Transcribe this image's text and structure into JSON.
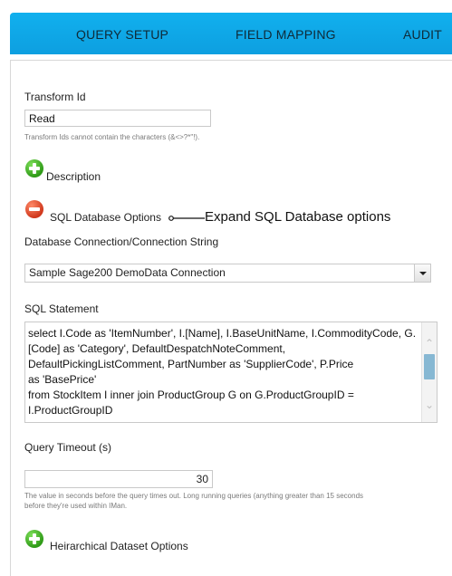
{
  "tabs": [
    {
      "label": "QUERY SETUP"
    },
    {
      "label": "FIELD MAPPING"
    },
    {
      "label": "AUDIT"
    }
  ],
  "transform": {
    "label": "Transform Id",
    "value": "Read",
    "hint": "Transform Ids cannot contain the characters (&<>?*\"!)."
  },
  "sections": {
    "description": "Description",
    "sql_options": "SQL Database Options",
    "hierarchical": "Heirarchical Dataset Options"
  },
  "callout": "Expand SQL Database options",
  "connection": {
    "label": "Database Connection/Connection String",
    "selected": "Sample Sage200 DemoData Connection"
  },
  "sql": {
    "label": "SQL Statement",
    "text": "select I.Code as 'ItemNumber', I.[Name], I.BaseUnitName, I.CommodityCode, G.[Code] as 'Category', DefaultDespatchNoteComment, DefaultPickingListComment, PartNumber as 'SupplierCode', P.Price\nas 'BasePrice'\nfrom StockItem I inner join ProductGroup G on G.ProductGroupID = I.ProductGroupID"
  },
  "timeout": {
    "label": "Query Timeout (s)",
    "value": "30",
    "hint_line1": "The value in seconds before the query times out. Long running queries (anything greater than 15 seconds",
    "hint_line2": "before they're used within IMan."
  },
  "colors": {
    "tab_bar": "#11b0ee",
    "plus_icon": "#3da51f",
    "minus_icon": "#e04a2d"
  },
  "icons": {
    "description": "plus-circle-icon",
    "sql_options": "minus-circle-icon",
    "hierarchical": "plus-circle-icon",
    "select_arrow": "chevron-down-icon"
  }
}
